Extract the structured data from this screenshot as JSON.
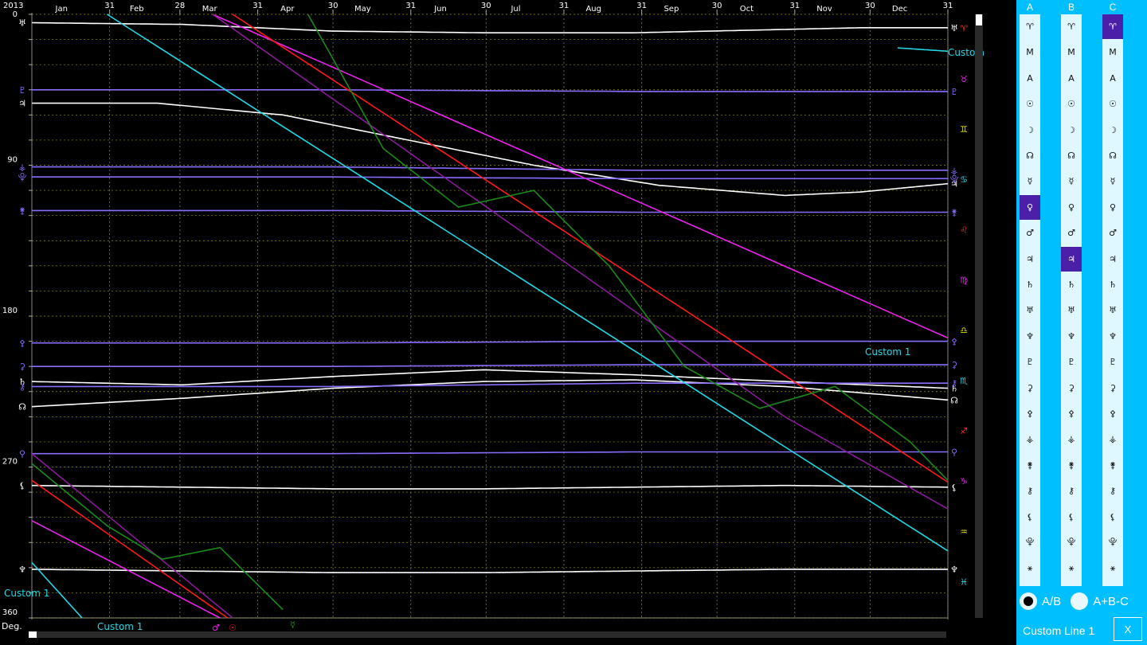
{
  "chart": {
    "year": "2013",
    "deg_label": "Deg.",
    "months": [
      "Jan",
      "Feb",
      "Mar",
      "Apr",
      "May",
      "Jun",
      "Jul",
      "Aug",
      "Sep",
      "Oct",
      "Nov",
      "Dec"
    ],
    "month_end_labels": [
      "31",
      "28",
      "31",
      "30",
      "31",
      "30",
      "31",
      "31",
      "30",
      "31",
      "30",
      "31"
    ],
    "y_ticks": [
      "0",
      "90",
      "180",
      "270",
      "360"
    ],
    "x_range_days": [
      0,
      365
    ],
    "y_range_deg": [
      0,
      360
    ],
    "right_zodiac_glyphs": [
      "♈",
      "♉",
      "♊",
      "♋",
      "♌",
      "♍",
      "♎",
      "♏",
      "♐",
      "♑",
      "♒",
      "♓"
    ],
    "custom_labels": [
      "Custom 1",
      "Custom 1",
      "Custom 1",
      "Custom 1"
    ],
    "bottom_glyphs": [
      "♂",
      "☉",
      "☿"
    ],
    "colors": {
      "grid_month": "#7a7a7a",
      "grid_deg": "#bfbf00",
      "white": "#ffffff",
      "violet": "#8a6cff",
      "cyan": "#22d8e6",
      "magenta": "#ee22ee",
      "red": "#ff1a1a",
      "green": "#1a8a1a",
      "purple": "#8a1a9a"
    },
    "chart_data": {
      "type": "line",
      "xlabel": "",
      "ylabel": "Deg.",
      "xlim": [
        0,
        365
      ],
      "ylim": [
        0,
        360
      ],
      "series": [
        {
          "color": "#ffffff",
          "x": [
            0,
            60,
            120,
            180,
            240,
            300,
            330,
            365
          ],
          "y": [
            5,
            6,
            10,
            11,
            11,
            9,
            8,
            8
          ],
          "start_glyph": "♅",
          "end_glyph": "♅"
        },
        {
          "color": "#ffffff",
          "x": [
            0,
            50,
            100,
            150,
            200,
            250,
            300,
            330,
            365
          ],
          "y": [
            53,
            53,
            60,
            75,
            90,
            102,
            108,
            106,
            101
          ],
          "start_glyph": "♃",
          "end_glyph": "♃"
        },
        {
          "color": "#ffffff",
          "x": [
            0,
            60,
            120,
            180,
            240,
            300,
            365
          ],
          "y": [
            234,
            229,
            223,
            219,
            218,
            222,
            230
          ],
          "start_glyph": "☊",
          "end_glyph": "☊"
        },
        {
          "color": "#ffffff",
          "x": [
            0,
            60,
            120,
            180,
            240,
            300,
            365
          ],
          "y": [
            219,
            221,
            216,
            212,
            215,
            219,
            223
          ],
          "start_glyph": "♄",
          "end_glyph": "♄"
        },
        {
          "color": "#ffffff",
          "x": [
            0,
            60,
            120,
            180,
            240,
            300,
            365
          ],
          "y": [
            281,
            282,
            283,
            283,
            282,
            281,
            282
          ],
          "start_glyph": "⚸",
          "end_glyph": "⚸"
        },
        {
          "color": "#ffffff",
          "x": [
            0,
            60,
            120,
            180,
            240,
            300,
            365
          ],
          "y": [
            331,
            332,
            333,
            333,
            332,
            331,
            331
          ],
          "start_glyph": "♆",
          "end_glyph": "♆"
        },
        {
          "color": "#8a6cff",
          "x": [
            0,
            120,
            240,
            365
          ],
          "y": [
            45,
            45,
            46,
            46
          ],
          "start_glyph": "♇",
          "end_glyph": "♇"
        },
        {
          "color": "#8a6cff",
          "x": [
            0,
            120,
            240,
            365
          ],
          "y": [
            91,
            91,
            93,
            93
          ],
          "start_glyph": "⚶",
          "end_glyph": "⚶"
        },
        {
          "color": "#8a6cff",
          "x": [
            0,
            120,
            240,
            365
          ],
          "y": [
            97,
            97,
            98,
            98
          ],
          "start_glyph": "⯓",
          "end_glyph": "⯓"
        },
        {
          "color": "#8a6cff",
          "x": [
            0,
            120,
            240,
            365
          ],
          "y": [
            117,
            117,
            118,
            118
          ],
          "start_glyph": "⚵",
          "end_glyph": "⚵"
        },
        {
          "color": "#8a6cff",
          "x": [
            0,
            120,
            240,
            365
          ],
          "y": [
            196,
            196,
            195,
            195
          ],
          "start_glyph": "⚴",
          "end_glyph": "⚴"
        },
        {
          "color": "#8a6cff",
          "x": [
            0,
            120,
            240,
            365
          ],
          "y": [
            210,
            210,
            209,
            209
          ],
          "start_glyph": "⚳",
          "end_glyph": "⚳"
        },
        {
          "color": "#8a6cff",
          "x": [
            0,
            120,
            240,
            365
          ],
          "y": [
            222,
            222,
            220,
            220
          ],
          "start_glyph": "⚷",
          "end_glyph": "⚷"
        },
        {
          "color": "#8a6cff",
          "x": [
            0,
            120,
            240,
            365
          ],
          "y": [
            262,
            262,
            261,
            261
          ],
          "start_glyph": "⚲",
          "end_glyph": "⚲"
        },
        {
          "color": "#22d8e6",
          "x": [
            30,
            365
          ],
          "y": [
            0,
            320
          ],
          "wrap": true,
          "label": "Custom 1"
        },
        {
          "color": "#22d8e6",
          "x": [
            345,
            365
          ],
          "y": [
            20,
            22
          ],
          "label": "Custom 1"
        },
        {
          "color": "#ee22ee",
          "x": [
            72,
            365
          ],
          "y": [
            0,
            193
          ],
          "wrap": true
        },
        {
          "color": "#ff1a1a",
          "x": [
            80,
            365
          ],
          "y": [
            0,
            279
          ],
          "wrap": true
        },
        {
          "color": "#8a1a9a",
          "x": [
            72,
            300,
            365
          ],
          "y": [
            0,
            240,
            295
          ],
          "wrap": true
        },
        {
          "color": "#1a8a1a",
          "x": [
            110,
            140,
            170,
            200,
            230,
            260,
            290,
            320,
            350,
            365
          ],
          "y": [
            0,
            80,
            115,
            105,
            150,
            210,
            235,
            222,
            255,
            278
          ],
          "wrap": true
        }
      ]
    }
  },
  "panel": {
    "columns": [
      {
        "label": "A",
        "items": [
          "♈",
          "M",
          "A",
          "☉",
          "☽",
          "☊",
          "☿",
          "♀",
          "♂",
          "♃",
          "♄",
          "♅",
          "♆",
          "♇",
          "⚳",
          "⚴",
          "⚶",
          "⚵",
          "⚷",
          "⚸",
          "⯓",
          "⚹"
        ],
        "selected": 7
      },
      {
        "label": "B",
        "items": [
          "♈",
          "M",
          "A",
          "☉",
          "☽",
          "☊",
          "☿",
          "♀",
          "♂",
          "♃",
          "♄",
          "♅",
          "♆",
          "♇",
          "⚳",
          "⚴",
          "⚶",
          "⚵",
          "⚷",
          "⚸",
          "⯓",
          "⚹"
        ],
        "selected": 9
      },
      {
        "label": "C",
        "items": [
          "♈",
          "M",
          "A",
          "☉",
          "☽",
          "☊",
          "☿",
          "♀",
          "♂",
          "♃",
          "♄",
          "♅",
          "♆",
          "♇",
          "⚳",
          "⚴",
          "⚶",
          "⚵",
          "⚷",
          "⚸",
          "⯓",
          "⚹"
        ],
        "selected": 0
      }
    ],
    "radio_ab": "A/B",
    "radio_abc": "A+B-C",
    "radio_selected": "A/B",
    "custom_line_label": "Custom Line 1",
    "close_label": "X",
    "accent": "#00bfff",
    "selected_color": "#4b1fa8"
  }
}
